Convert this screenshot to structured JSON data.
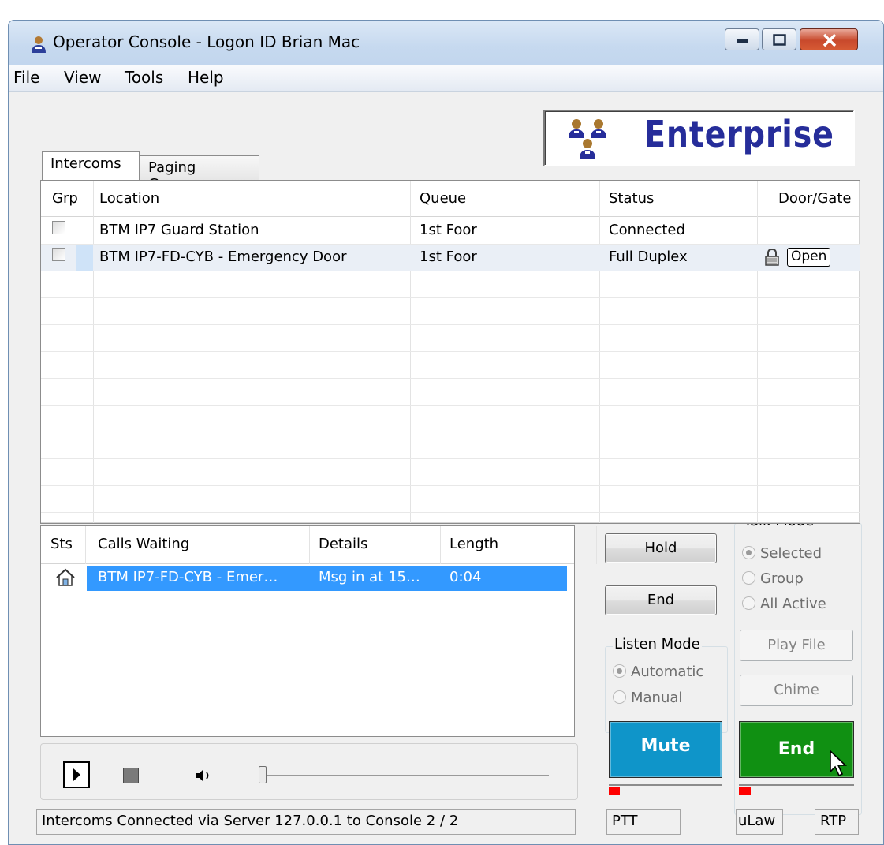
{
  "window": {
    "title": "Operator Console - Logon ID Brian Mac",
    "controls": {
      "minimize": "minimize",
      "maximize": "maximize",
      "close": "close"
    }
  },
  "menu": [
    "File",
    "View",
    "Tools",
    "Help"
  ],
  "logo": {
    "text": "Enterprise",
    "icon": "people-group-icon"
  },
  "tabs": [
    {
      "label": "Intercoms",
      "active": true
    },
    {
      "label": "Paging Groups",
      "active": false
    }
  ],
  "intercoms": {
    "columns": [
      "Grp",
      "Location",
      "Queue",
      "Status",
      "Door/Gate"
    ],
    "rows": [
      {
        "grp_checked": false,
        "location": "BTM IP7 Guard Station",
        "queue": "1st Foor",
        "status": "Connected",
        "door": ""
      },
      {
        "grp_checked": false,
        "location": "BTM IP7-FD-CYB - Emergency Door",
        "queue": "1st Foor",
        "status": "Full Duplex",
        "door": "Open",
        "door_icon": "lock-icon"
      }
    ]
  },
  "calls": {
    "columns": [
      "Sts",
      "Calls Waiting",
      "Details",
      "Length"
    ],
    "rows": [
      {
        "icon": "house-icon",
        "caller": "BTM IP7-FD-CYB - Emer…",
        "details": "Msg in at 15…",
        "length": "0:04",
        "selected": true
      }
    ]
  },
  "player": {
    "play": "play-icon",
    "stop": "stop-icon",
    "volume": "speaker-icon",
    "position": 0
  },
  "buttons": {
    "hold": "Hold",
    "end_call": "End",
    "play_file": "Play File",
    "chime": "Chime",
    "mute": "Mute",
    "end_talk": "End"
  },
  "listen_mode": {
    "label": "Listen Mode",
    "options": [
      "Automatic",
      "Manual"
    ],
    "selected": "Automatic"
  },
  "talk_mode": {
    "label": "Talk Mode",
    "options": [
      "Selected",
      "Group",
      "All Active"
    ],
    "selected": "Selected"
  },
  "levels": {
    "mute": 0.1,
    "end": 0.1
  },
  "status_bar": {
    "message": "Intercoms Connected via Server 127.0.0.1 to Console 2 / 2",
    "ptt": "PTT",
    "codec": "uLaw",
    "transport": "RTP"
  },
  "colors": {
    "mute_button": "#0f95c9",
    "end_button": "#109012",
    "selection": "#3399ff",
    "logo_text": "#262d9a",
    "level": "#ff0000"
  }
}
